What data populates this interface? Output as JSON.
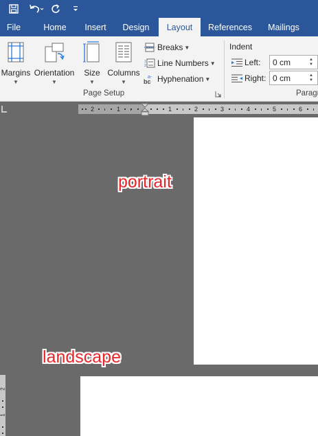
{
  "quick_access": {
    "save_icon": "save-icon",
    "undo_icon": "undo-icon",
    "redo_icon": "repeat-icon",
    "customize_icon": "customize-toolbar-icon"
  },
  "tabs": [
    {
      "label": "File",
      "active": false
    },
    {
      "label": "Home",
      "active": false
    },
    {
      "label": "Insert",
      "active": false
    },
    {
      "label": "Design",
      "active": false
    },
    {
      "label": "Layout",
      "active": true
    },
    {
      "label": "References",
      "active": false
    },
    {
      "label": "Mailings",
      "active": false
    }
  ],
  "ribbon": {
    "page_setup": {
      "margins": "Margins",
      "orientation": "Orientation",
      "size": "Size",
      "columns": "Columns",
      "breaks": "Breaks",
      "line_numbers": "Line Numbers",
      "hyphenation": "Hyphenation",
      "group_label": "Page Setup"
    },
    "indent": {
      "title": "Indent",
      "left_label": "Left:",
      "left_value": "0 cm",
      "right_label": "Right:",
      "right_value": "0 cm"
    },
    "paragraph_group_label": "Paragr"
  },
  "ruler": {
    "labels": [
      "2",
      "1",
      "1",
      "2",
      "3",
      "4",
      "5",
      "6"
    ],
    "vertical_labels": [
      "2",
      "1"
    ]
  },
  "annotations": {
    "portrait": "portrait",
    "landscape": "landscape"
  },
  "colors": {
    "title_bar": "#2b579a",
    "ribbon_bg": "#f3f3f3",
    "workspace": "#6a6a6a",
    "annotation": "#e8262a"
  }
}
